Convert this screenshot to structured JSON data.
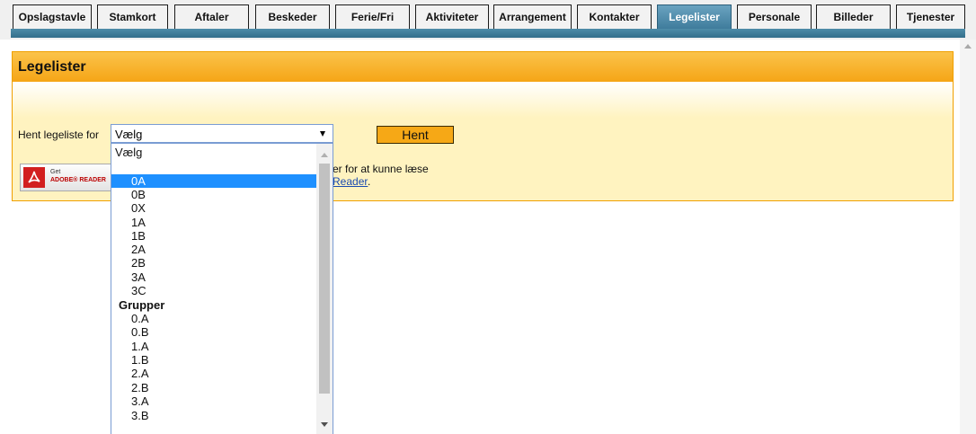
{
  "nav": {
    "items": [
      {
        "label": "Opslagstavle"
      },
      {
        "label": "Stamkort"
      },
      {
        "label": "Aftaler"
      },
      {
        "label": "Beskeder"
      },
      {
        "label": "Ferie/Fri"
      },
      {
        "label": "Aktiviteter"
      },
      {
        "label": "Arrangement"
      },
      {
        "label": "Kontakter"
      },
      {
        "label": "Legelister",
        "active": true
      },
      {
        "label": "Personale"
      },
      {
        "label": "Billeder"
      },
      {
        "label": "Tjenester"
      }
    ]
  },
  "panel": {
    "title": "Legelister",
    "fetch_label": "Hent legeliste for",
    "select_value": "Vælg",
    "fetch_button": "Hent",
    "adobe_get": "Get",
    "adobe_name": "ADOBE® READER",
    "reader_text": "er for at kunne læse",
    "reader_link": "Reader",
    "reader_dot": "."
  },
  "dropdown": {
    "options": [
      {
        "label": "Vælg"
      },
      {
        "label": ""
      },
      {
        "label": "0A",
        "selected": true
      },
      {
        "label": "0B"
      },
      {
        "label": "0X"
      },
      {
        "label": "1A"
      },
      {
        "label": "1B"
      },
      {
        "label": "2A"
      },
      {
        "label": "2B"
      },
      {
        "label": "3A"
      },
      {
        "label": "3C"
      },
      {
        "label": "Grupper",
        "group": true
      },
      {
        "label": "0.A"
      },
      {
        "label": "0.B"
      },
      {
        "label": "1.A"
      },
      {
        "label": "1.B"
      },
      {
        "label": "2.A"
      },
      {
        "label": "2.B"
      },
      {
        "label": "3.A"
      },
      {
        "label": "3.B"
      }
    ]
  },
  "colors": {
    "header_orange": "#f5a516",
    "panel_bg": "#fff3c0",
    "nav_active": "#3f7c9c",
    "selection": "#1e90ff"
  }
}
